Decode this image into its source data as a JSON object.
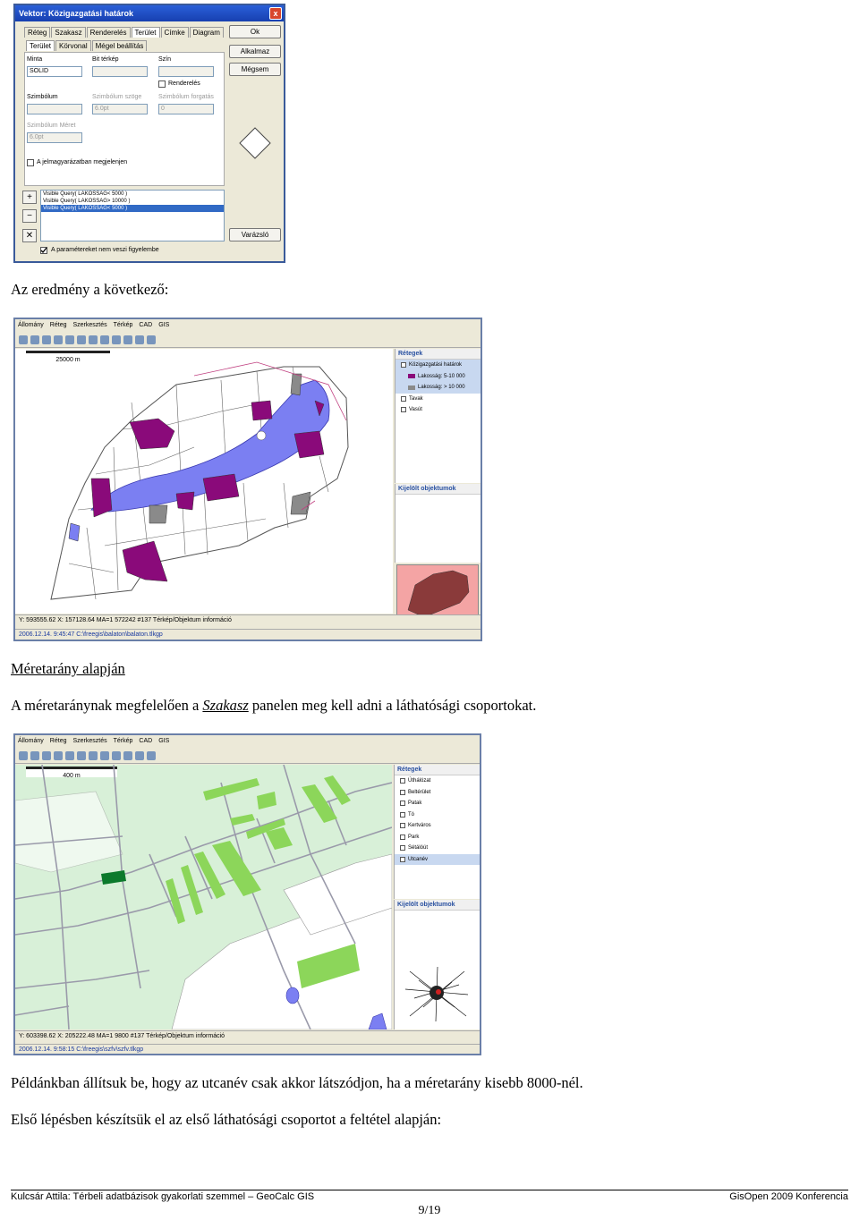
{
  "dialog": {
    "title": "Vektor: Közigazgatási határok",
    "close": "x",
    "tabs": [
      "Réteg",
      "Szakasz",
      "Renderelés",
      "Terület",
      "Címke",
      "Diagram"
    ],
    "subtabs": [
      "Terület",
      "Körvonal",
      "Mégel beállítás"
    ],
    "buttons": {
      "ok": "Ok",
      "apply": "Alkalmaz",
      "cancel": "Mégsem",
      "wizard": "Varázsló"
    },
    "labels": {
      "pattern": "Minta",
      "bitmap": "Bit térkép",
      "color": "Szín",
      "render": "Renderelés",
      "symbol": "Szimbólum",
      "symbol_angle": "Szimbólum szöge",
      "symbol_rotation": "Szimbólum forgatás",
      "symbol_size": "Szimbólum Méret",
      "legend_show": "A jelmagyarázatban megjelenjen",
      "ignore_params": "A paramétereket nem veszi figyelembe"
    },
    "values": {
      "pattern": "SOLID",
      "symbol_angle": "6.0pt",
      "symbol_rotation": "0",
      "symbol_size": "6.0pt"
    },
    "list_items": [
      "Visible Query( LAKOSSAG< 5000 )",
      "Visible Query( LAKOSSAG> 10000 )",
      "Visible Query( LAKOSSAG< 5000 )"
    ],
    "plus": "+",
    "minus": "−",
    "delete": "✕"
  },
  "text": {
    "result": "Az eredmény a következő:",
    "heading": "Méretarány alapján",
    "para1_before": "A méretaránynak megfelelően a ",
    "para1_link": "Szakasz",
    "para1_after": " panelen meg kell adni a láthatósági csoportokat.",
    "para2": "Példánkban állítsuk be, hogy az utcanév csak akkor látszódjon, ha a méretarány kisebb 8000-nél.",
    "para3": "Első lépésben készítsük el az első láthatósági csoportot a feltétel alapján:"
  },
  "app1": {
    "menu": [
      "Állomány",
      "Réteg",
      "Szerkesztés",
      "Térkép",
      "CAD",
      "GIS"
    ],
    "scale": "25000 m",
    "layers_title": "Rétegek",
    "layers": [
      "Közigazgatási határok",
      "Lakosság: 5-10 000",
      "Lakosság: > 10 000",
      "Tavak",
      "Vasút"
    ],
    "selected_title": "Kijelölt objektumok",
    "status": "Y: 593555.62   X: 157128.64   MA=1   572242   #137   Térkép/Objektum információ",
    "path": "2006.12.14. 9:45:47   C:\\freegis\\balaton\\balaton.tlkgp"
  },
  "app2": {
    "menu": [
      "Állomány",
      "Réteg",
      "Szerkesztés",
      "Térkép",
      "CAD",
      "GIS"
    ],
    "scale": "400 m",
    "layers_title": "Rétegek",
    "layers": [
      "Útháló­zat",
      "Beltérület",
      "Patak",
      "Tó",
      "Kertváros",
      "Park",
      "Sétálóút",
      "Utcanév"
    ],
    "selected_title": "Kijelölt objektumok",
    "status": "Y: 603398.62   X: 205222.48   MA=1   9800   #137   Térkép/Objektum információ",
    "path": "2006.12.14. 9:58:15   C:\\freegis\\szfv\\szfv.tlkgp"
  },
  "footer": {
    "left": "Kulcsár Attila: Térbeli adatbázisok gyakorlati szemmel – GeoCalc GIS",
    "right": "GisOpen 2009 Konferencia",
    "page": "9/19"
  },
  "colors": {
    "purple": "#8a0a7a",
    "lake": "#7b7ff2",
    "grey": "#8a8a8a",
    "green_bg": "#d8f0d8",
    "park": "#8cd65a",
    "highlight": "#f4a4a4"
  }
}
